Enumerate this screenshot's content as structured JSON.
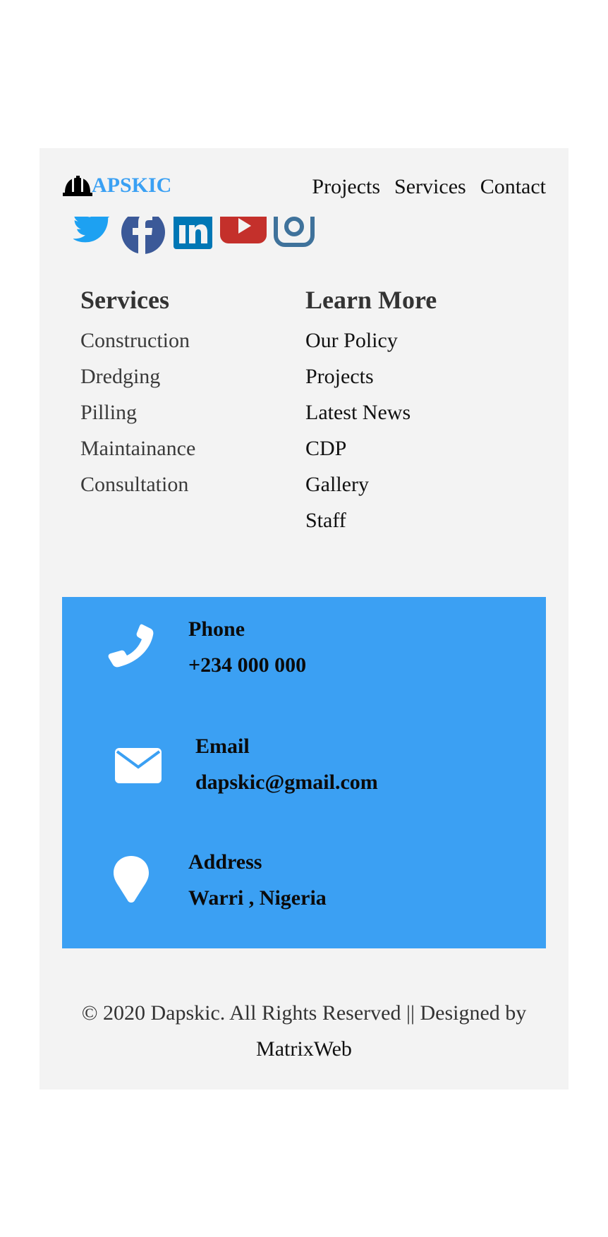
{
  "header": {
    "brand": "APSKIC",
    "nav": [
      "Projects",
      "Services",
      "Contact"
    ]
  },
  "social": [
    {
      "name": "twitter-icon",
      "color": "#1da1f2"
    },
    {
      "name": "facebook-icon",
      "color": "#3b5998"
    },
    {
      "name": "linkedin-icon",
      "color": "#0077b5"
    },
    {
      "name": "youtube-icon",
      "color": "#c4302b"
    },
    {
      "name": "instagram-icon",
      "color": "#3f729b"
    }
  ],
  "services": {
    "title": "Services",
    "items": [
      "Construction",
      "Dredging",
      "Pilling",
      "Maintainance",
      "Consultation"
    ]
  },
  "learn_more": {
    "title": "Learn More",
    "items": [
      "Our Policy",
      "Projects",
      "Latest News",
      "CDP",
      "Gallery",
      "Staff"
    ]
  },
  "contact": {
    "phone": {
      "label": "Phone",
      "value": "+234 000 000",
      "icon": "phone-icon"
    },
    "email": {
      "label": "Email",
      "value": "dapskic@gmail.com",
      "icon": "envelope-icon"
    },
    "address": {
      "label": "Address",
      "value": "Warri , Nigeria",
      "icon": "map-pin-icon"
    }
  },
  "footer": {
    "copyright": "© 2020 Dapskic. All Rights Reserved || Designed by",
    "author": "MatrixWeb"
  },
  "colors": {
    "accent": "#3aa0f3",
    "contact_bg": "#3ba0f3",
    "footer_bg": "#f3f3f3"
  }
}
